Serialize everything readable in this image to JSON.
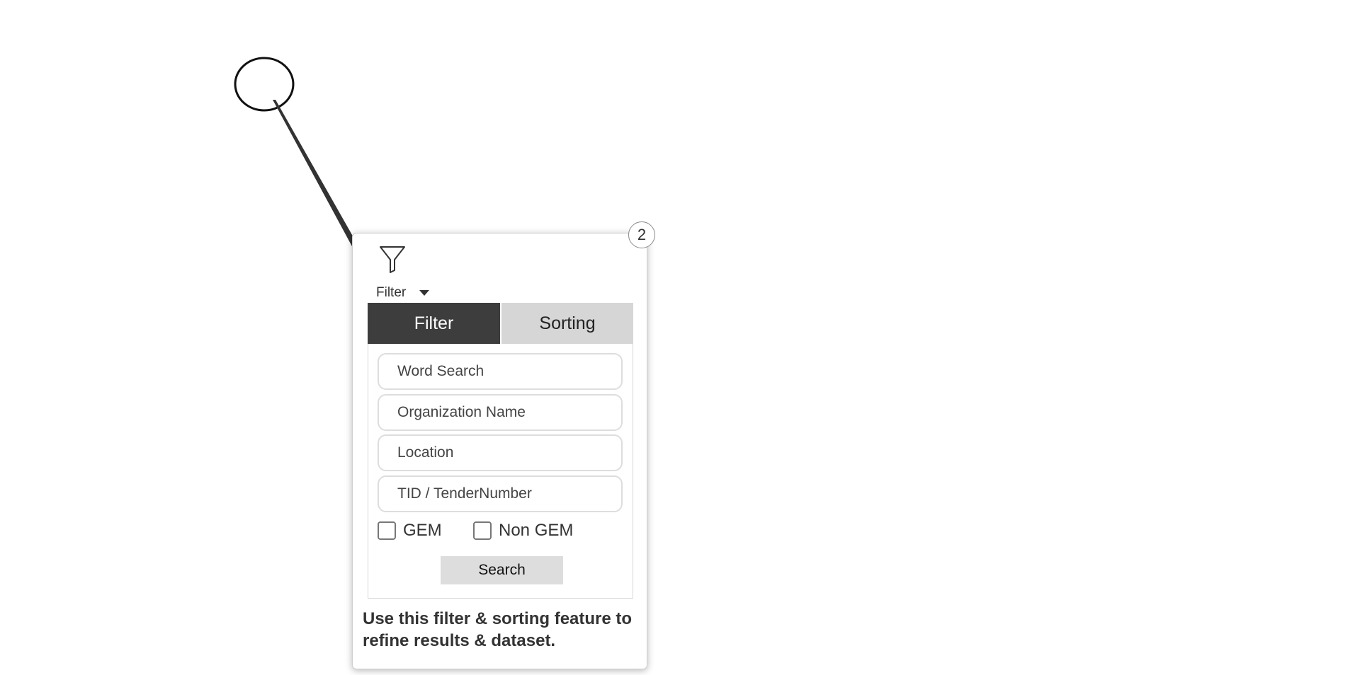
{
  "tour": {
    "step_number": "2",
    "description": "Use this filter & sorting feature to refine results & dataset."
  },
  "filter_toggle": {
    "label": "Filter",
    "icon": "funnel-icon"
  },
  "tabs": [
    {
      "label": "Filter",
      "active": true
    },
    {
      "label": "Sorting",
      "active": false
    }
  ],
  "fields": {
    "word_search": {
      "placeholder": "Word Search",
      "value": ""
    },
    "organization_name": {
      "placeholder": "Organization Name",
      "value": ""
    },
    "location": {
      "placeholder": "Location",
      "value": ""
    },
    "tender_number": {
      "placeholder": "TID / TenderNumber",
      "value": ""
    }
  },
  "checkboxes": [
    {
      "label": "GEM",
      "checked": false
    },
    {
      "label": "Non GEM",
      "checked": false
    }
  ],
  "search_button": {
    "label": "Search"
  },
  "colors": {
    "active_tab": "#3d3d3d",
    "inactive_tab": "#d6d6d6",
    "button": "#dddddd"
  }
}
